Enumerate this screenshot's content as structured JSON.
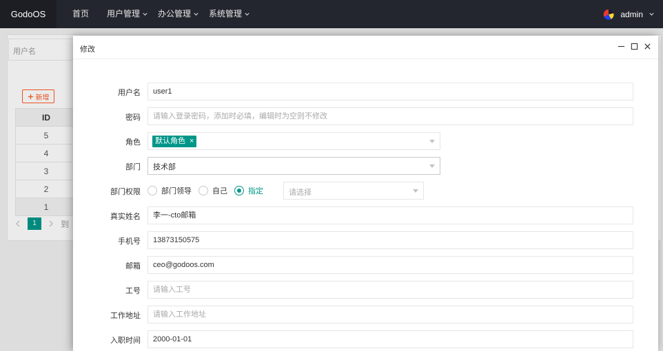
{
  "brand": "GodoOS",
  "nav": {
    "home": "首页",
    "user_mgmt": "用户管理",
    "office_mgmt": "办公管理",
    "system_mgmt": "系统管理"
  },
  "user": {
    "name": "admin"
  },
  "background": {
    "search_placeholder": "用户名",
    "add_button": "新增",
    "table_header": "ID",
    "rows": [
      "5",
      "4",
      "3",
      "2",
      "1"
    ],
    "page_current": "1",
    "pager_goto": "到"
  },
  "modal": {
    "title": "修改",
    "fields": {
      "username": {
        "label": "用户名",
        "value": "user1"
      },
      "password": {
        "label": "密码",
        "placeholder": "请输入登录密码，添加时必填，编辑时为空则不修改"
      },
      "role": {
        "label": "角色",
        "tag": "默认角色"
      },
      "dept": {
        "label": "部门",
        "value": "技术部"
      },
      "dept_scope": {
        "label": "部门权限",
        "options": [
          "部门领导",
          "自己",
          "指定"
        ],
        "selected": "指定",
        "select_placeholder": "请选择"
      },
      "realname": {
        "label": "真实姓名",
        "value": "李一-cto邮箱"
      },
      "phone": {
        "label": "手机号",
        "value": "13873150575"
      },
      "email": {
        "label": "邮箱",
        "value": "ceo@godoos.com"
      },
      "job_no": {
        "label": "工号",
        "placeholder": "请输入工号"
      },
      "work_addr": {
        "label": "工作地址",
        "placeholder": "请输入工作地址"
      },
      "join_date": {
        "label": "入职时间",
        "value": "2000-01-01"
      }
    }
  },
  "colors": {
    "primary": "#009688",
    "accent": "#ff5722",
    "topbar": "#23262e"
  }
}
